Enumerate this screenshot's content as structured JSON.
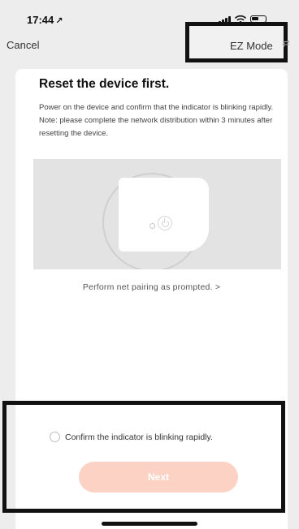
{
  "status_bar": {
    "time": "17:44",
    "location_icon": "location-arrow-icon"
  },
  "nav": {
    "cancel_label": "Cancel",
    "mode_label": "EZ Mode",
    "mode_icon": "switch-arrows-icon"
  },
  "content": {
    "title": "Reset the device first.",
    "description": [
      "Power on the device and confirm that the indicator is blinking rapidly.",
      "Note: please complete the network distribution within 3 minutes after resetting the device."
    ],
    "pairing_link": "Perform net pairing as prompted. >"
  },
  "footer": {
    "confirm_label": "Confirm the indicator is blinking rapidly.",
    "confirm_checked": false,
    "next_label": "Next",
    "next_color": "#fbd2c4"
  }
}
